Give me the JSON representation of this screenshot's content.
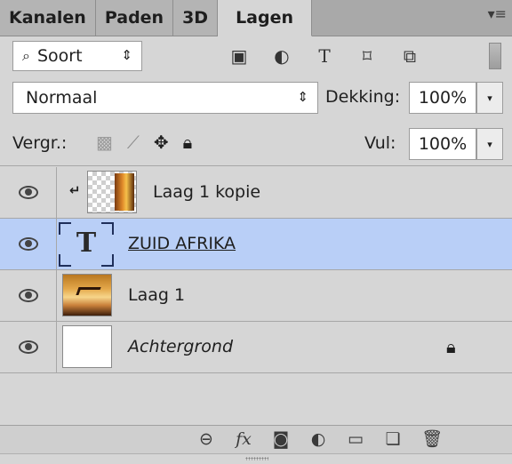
{
  "tabs": [
    {
      "label": "Kanalen",
      "active": false
    },
    {
      "label": "Paden",
      "active": false
    },
    {
      "label": "3D",
      "active": false
    },
    {
      "label": "Lagen",
      "active": true
    }
  ],
  "filter": {
    "kind_label": "Soort",
    "icons": [
      "image-filter-icon",
      "adjustment-filter-icon",
      "type-filter-icon",
      "shape-filter-icon",
      "smart-object-filter-icon"
    ]
  },
  "blend": {
    "mode": "Normaal",
    "opacity_label": "Dekking:",
    "opacity_value": "100%"
  },
  "lock": {
    "label": "Vergr.:",
    "fill_label": "Vul:",
    "fill_value": "100%"
  },
  "layers": [
    {
      "name": "Laag 1 kopie",
      "type": "clipped-pixel",
      "visible": true,
      "selected": false
    },
    {
      "name": "ZUID AFRIKA",
      "type": "text",
      "visible": true,
      "selected": true
    },
    {
      "name": "Laag 1",
      "type": "pixel",
      "visible": true,
      "selected": false
    },
    {
      "name": "Achtergrond",
      "type": "background",
      "visible": true,
      "selected": false,
      "locked": true
    }
  ],
  "colors": {
    "panel_bg": "#d6d6d6",
    "tabbar_bg": "#a9a9a9",
    "selection": "#b9cff7"
  }
}
